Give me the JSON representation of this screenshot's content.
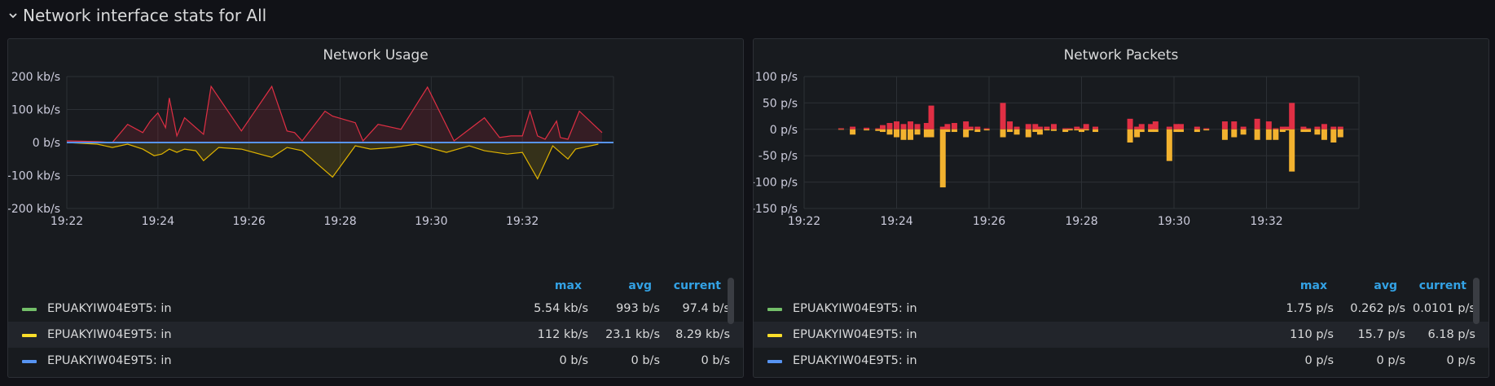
{
  "row": {
    "title": "Network interface stats for All"
  },
  "panels": [
    {
      "title": "Network Usage",
      "legend": {
        "headers": [
          "max",
          "avg",
          "current"
        ],
        "rows": [
          {
            "name": "EPUAKYIW04E9T5: in",
            "color": "#73bf69",
            "max": "5.54 kb/s",
            "avg": "993 b/s",
            "current": "97.4 b/s"
          },
          {
            "name": "EPUAKYIW04E9T5: in",
            "color": "#fade2a",
            "max": "112 kb/s",
            "avg": "23.1 kb/s",
            "current": "8.29 kb/s"
          },
          {
            "name": "EPUAKYIW04E9T5: in",
            "color": "#5794f2",
            "max": "0 b/s",
            "avg": "0 b/s",
            "current": "0 b/s"
          }
        ]
      }
    },
    {
      "title": "Network Packets",
      "legend": {
        "headers": [
          "max",
          "avg",
          "current"
        ],
        "rows": [
          {
            "name": "EPUAKYIW04E9T5: in",
            "color": "#73bf69",
            "max": "1.75 p/s",
            "avg": "0.262 p/s",
            "current": "0.0101 p/s"
          },
          {
            "name": "EPUAKYIW04E9T5: in",
            "color": "#fade2a",
            "max": "110 p/s",
            "avg": "15.7 p/s",
            "current": "6.18 p/s"
          },
          {
            "name": "EPUAKYIW04E9T5: in",
            "color": "#5794f2",
            "max": "0 p/s",
            "avg": "0 p/s",
            "current": "0 p/s"
          }
        ]
      }
    }
  ],
  "chart_data": [
    {
      "type": "area",
      "title": "Network Usage",
      "ylim": [
        -200,
        200
      ],
      "yticks": [
        "200 kb/s",
        "100 kb/s",
        "0 b/s",
        "-100 kb/s",
        "-200 kb/s"
      ],
      "ytick_values": [
        200,
        100,
        0,
        -100,
        -200
      ],
      "xtick_labels": [
        "19:22",
        "19:24",
        "19:26",
        "19:28",
        "19:30",
        "19:32"
      ],
      "xlim": [
        "19:22",
        "19:34"
      ],
      "grid": true,
      "series": [
        {
          "color": "#e02f44",
          "points": [
            [
              "19:22",
              5
            ],
            [
              "19:22:40",
              3
            ],
            [
              "19:23",
              0
            ],
            [
              "19:23:20",
              55
            ],
            [
              "19:23:40",
              30
            ],
            [
              "19:23:50",
              65
            ],
            [
              "19:24:00",
              90
            ],
            [
              "19:24:10",
              45
            ],
            [
              "19:24:15",
              135
            ],
            [
              "19:24:25",
              20
            ],
            [
              "19:24:35",
              75
            ],
            [
              "19:24:50",
              45
            ],
            [
              "19:25",
              25
            ],
            [
              "19:25:10",
              170
            ],
            [
              "19:25:50",
              35
            ],
            [
              "19:26:30",
              170
            ],
            [
              "19:26:50",
              35
            ],
            [
              "19:27:00",
              30
            ],
            [
              "19:27:10",
              5
            ],
            [
              "19:27:40",
              95
            ],
            [
              "19:27:50",
              80
            ],
            [
              "19:28:20",
              60
            ],
            [
              "19:28:30",
              5
            ],
            [
              "19:28:50",
              55
            ],
            [
              "19:29:20",
              40
            ],
            [
              "19:29:55",
              168
            ],
            [
              "19:30:30",
              5
            ],
            [
              "19:31:10",
              75
            ],
            [
              "19:31:30",
              15
            ],
            [
              "19:31:45",
              20
            ],
            [
              "19:32",
              20
            ],
            [
              "19:32:10",
              95
            ],
            [
              "19:32:20",
              20
            ],
            [
              "19:32:30",
              10
            ],
            [
              "19:32:45",
              65
            ],
            [
              "19:32:50",
              15
            ],
            [
              "19:33:00",
              10
            ],
            [
              "19:33:15",
              95
            ],
            [
              "19:33:45",
              30
            ]
          ]
        },
        {
          "color": "#e0b400",
          "points": [
            [
              "19:22",
              0
            ],
            [
              "19:22:40",
              -5
            ],
            [
              "19:23:00",
              -15
            ],
            [
              "19:23:20",
              -5
            ],
            [
              "19:23:40",
              -20
            ],
            [
              "19:23:55",
              -40
            ],
            [
              "19:24:05",
              -35
            ],
            [
              "19:24:15",
              -20
            ],
            [
              "19:24:25",
              -30
            ],
            [
              "19:24:35",
              -20
            ],
            [
              "19:24:50",
              -25
            ],
            [
              "19:25:00",
              -55
            ],
            [
              "19:25:20",
              -15
            ],
            [
              "19:25:50",
              -20
            ],
            [
              "19:26:30",
              -45
            ],
            [
              "19:26:50",
              -15
            ],
            [
              "19:27:10",
              -25
            ],
            [
              "19:27:50",
              -105
            ],
            [
              "19:28:20",
              -10
            ],
            [
              "19:28:40",
              -20
            ],
            [
              "19:29:10",
              -15
            ],
            [
              "19:29:40",
              -5
            ],
            [
              "19:30:20",
              -30
            ],
            [
              "19:30:50",
              -10
            ],
            [
              "19:31:10",
              -25
            ],
            [
              "19:31:40",
              -35
            ],
            [
              "19:32:00",
              -30
            ],
            [
              "19:32:20",
              -110
            ],
            [
              "19:32:40",
              -10
            ],
            [
              "19:33:00",
              -50
            ],
            [
              "19:33:10",
              -20
            ],
            [
              "19:33:40",
              -5
            ]
          ]
        },
        {
          "color": "#5794f2",
          "points": [
            [
              "19:22",
              0
            ],
            [
              "19:34",
              0
            ]
          ]
        }
      ]
    },
    {
      "type": "bar",
      "title": "Network Packets",
      "ylim": [
        -150,
        100
      ],
      "yticks": [
        "100 p/s",
        "50 p/s",
        "0 p/s",
        "-50 p/s",
        "-100 p/s",
        "-150 p/s"
      ],
      "ytick_values": [
        100,
        50,
        0,
        -50,
        -100,
        -150
      ],
      "xtick_labels": [
        "19:22",
        "19:24",
        "19:26",
        "19:28",
        "19:30",
        "19:32"
      ],
      "xlim": [
        "19:22",
        "19:34"
      ],
      "grid": true,
      "series": [
        {
          "color": "#e02f44",
          "x_minutes": [
            0.8,
            1.05,
            1.35,
            1.6,
            1.7,
            1.85,
            2.0,
            2.15,
            2.3,
            2.45,
            2.65,
            2.75,
            3.0,
            3.1,
            3.25,
            3.5,
            3.6,
            3.75,
            3.95,
            4.3,
            4.45,
            4.6,
            4.85,
            5.0,
            5.1,
            5.25,
            5.4,
            5.65,
            5.75,
            5.9,
            6.0,
            6.1,
            6.3,
            7.05,
            7.2,
            7.3,
            7.5,
            7.6,
            7.9,
            8.05,
            8.15,
            8.5,
            8.7,
            9.1,
            9.3,
            9.5,
            9.8,
            10.05,
            10.2,
            10.35,
            10.45,
            10.55,
            10.8,
            10.9,
            11.1,
            11.25,
            11.45,
            11.6
          ],
          "values": [
            2,
            5,
            3,
            2,
            8,
            12,
            15,
            10,
            15,
            10,
            12,
            45,
            5,
            10,
            12,
            15,
            5,
            5,
            2,
            50,
            15,
            5,
            10,
            10,
            5,
            5,
            10,
            2,
            2,
            5,
            2,
            10,
            5,
            20,
            5,
            10,
            10,
            15,
            5,
            10,
            10,
            5,
            2,
            15,
            15,
            5,
            20,
            15,
            2,
            5,
            5,
            50,
            5,
            2,
            5,
            10,
            5,
            5
          ],
          "values_neg": [
            0,
            -10,
            -2,
            -3,
            -5,
            -10,
            -15,
            -20,
            -20,
            -10,
            -15,
            -15,
            -110,
            -5,
            -5,
            -15,
            -2,
            -5,
            -2,
            -15,
            -5,
            -10,
            -15,
            -5,
            -10,
            -2,
            -3,
            -5,
            -2,
            -2,
            -5,
            -2,
            -5,
            -25,
            -15,
            -5,
            -5,
            -5,
            -60,
            -5,
            -5,
            -5,
            -2,
            -20,
            -15,
            -10,
            -20,
            -20,
            -20,
            -5,
            -2,
            -80,
            -5,
            -5,
            -10,
            -20,
            -25,
            -15
          ]
        }
      ]
    }
  ]
}
